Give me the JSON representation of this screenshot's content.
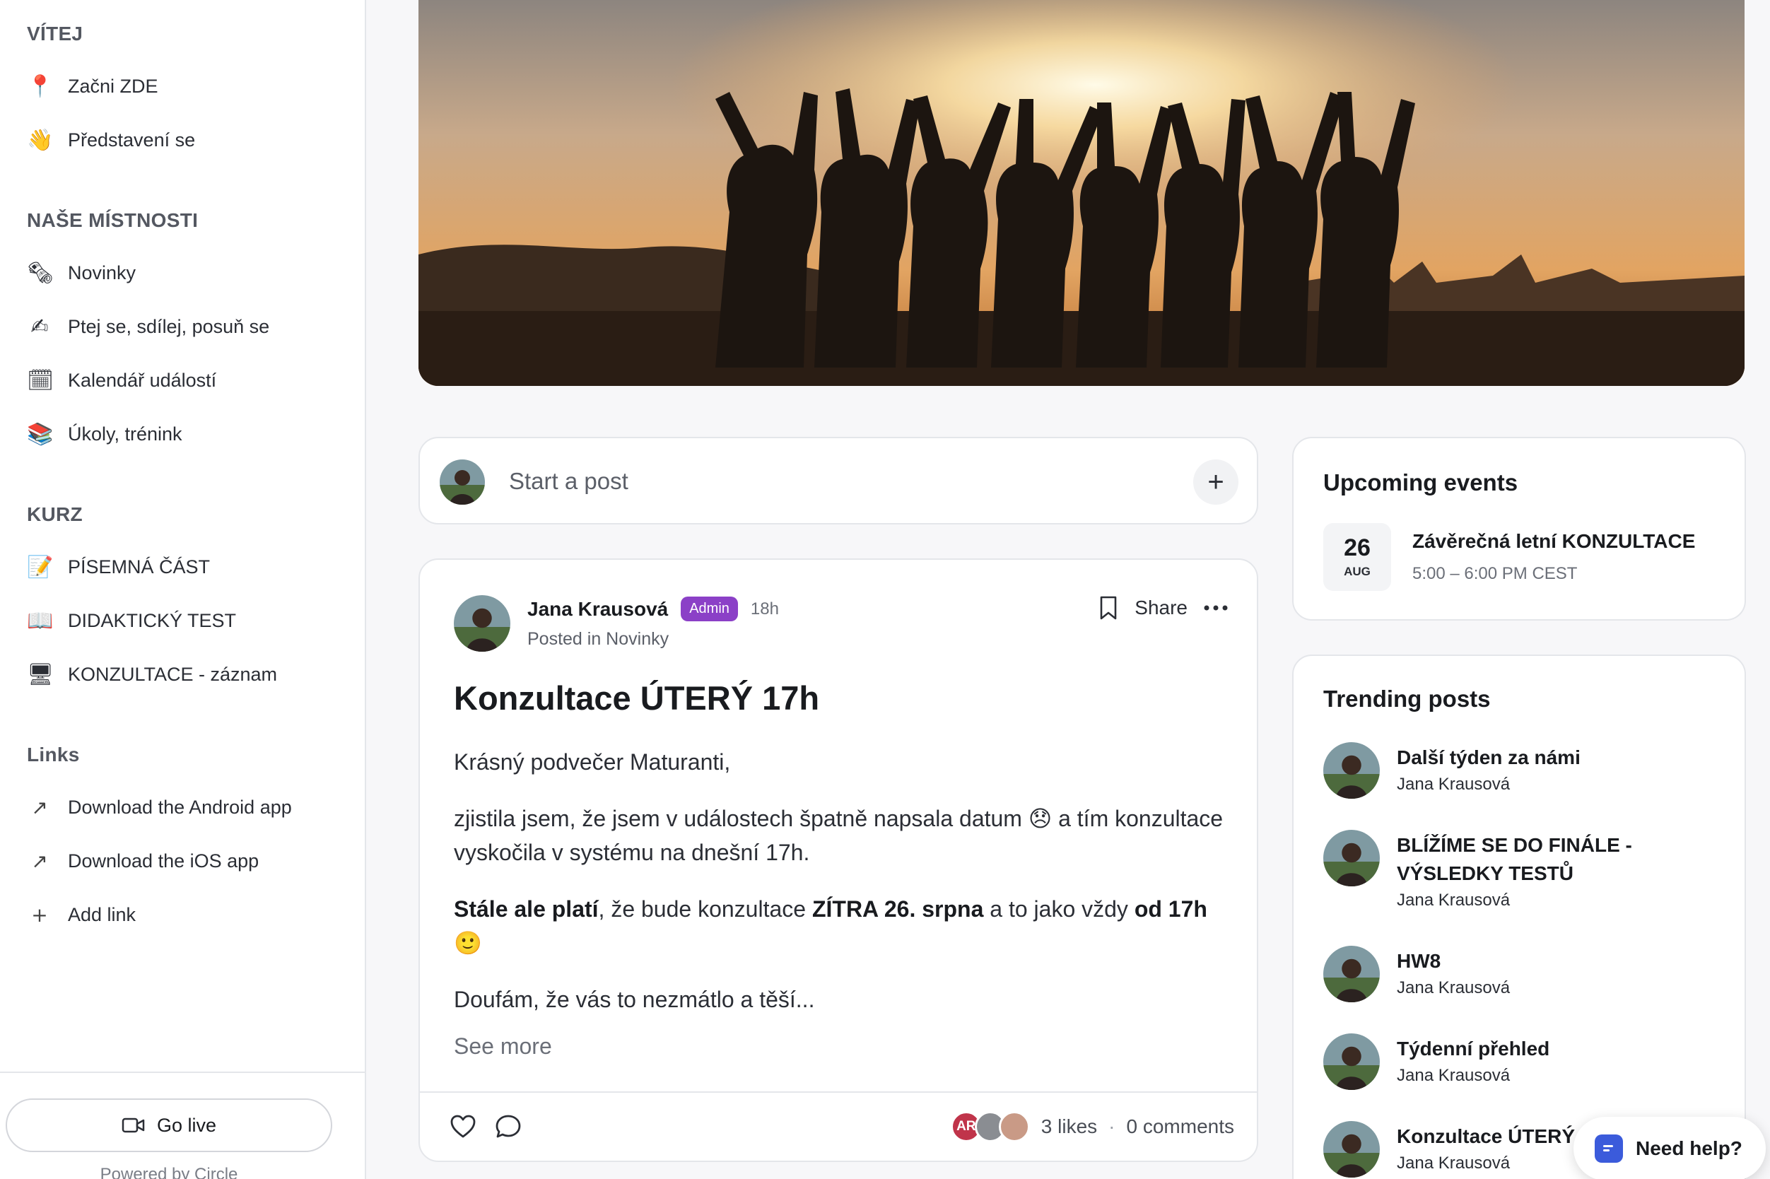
{
  "sidebar": {
    "sections": [
      {
        "title": "VÍTEJ"
      },
      {
        "title": "NAŠE MÍSTNOSTI"
      },
      {
        "title": "KURZ"
      },
      {
        "title": "Links"
      }
    ],
    "items": [
      {
        "label": "Začni ZDE",
        "icon": "📍"
      },
      {
        "label": "Představení se",
        "icon": "👋"
      },
      {
        "label": "Novinky",
        "icon": "🗞"
      },
      {
        "label": "Ptej se, sdílej, posuň se",
        "icon": "✍"
      },
      {
        "label": "Kalendář událostí",
        "icon": "🗓"
      },
      {
        "label": "Úkoly, trénink",
        "icon": "📚"
      },
      {
        "label": "PÍSEMNÁ ČÁST",
        "icon": "📝"
      },
      {
        "label": "DIDAKTICKÝ TEST",
        "icon": "📖"
      },
      {
        "label": "KONZULTACE - záznam",
        "icon": "🖥"
      },
      {
        "label": "Download the Android app",
        "icon": "↗"
      },
      {
        "label": "Download the iOS app",
        "icon": "↗"
      },
      {
        "label": "Add link",
        "icon": "+"
      }
    ],
    "go_live": "Go live",
    "powered_by": "Powered by Circle"
  },
  "composer": {
    "placeholder": "Start a post",
    "plus": "+"
  },
  "post": {
    "author": "Jana Krausová",
    "badge": "Admin",
    "time": "18h",
    "posted_in": "Posted in Novinky",
    "share": "Share",
    "title": "Konzultace ÚTERÝ 17h",
    "p1": "Krásný podvečer Maturanti,",
    "p2a": "zjistila jsem, že jsem v událostech špatně napsala datum",
    "p2emoji": "😞",
    "p2b": "a tím konzultace vyskočila v systému na dnešní 17h.",
    "p3_bold1": "Stále ale platí",
    "p3_t1": ", že bude konzultace ",
    "p3_bold2": "ZÍTRA 26. srpna",
    "p3_t2": " a to jako vždy ",
    "p3_bold3": "od 17h",
    "p3emoji": "🙂",
    "p4": "Doufám, že vás to nezmátlo a těší...",
    "see_more": "See more",
    "liker_initials": "AR",
    "likes": "3 likes",
    "separator": "·",
    "comments": "0 comments"
  },
  "events": {
    "title": "Upcoming events",
    "day": "26",
    "month": "AUG",
    "event_title": "Závěrečná letní KONZULTACE",
    "event_time": "5:00 – 6:00 PM CEST"
  },
  "trending": {
    "title": "Trending posts",
    "items": [
      {
        "title": "Další týden za námi",
        "author": "Jana Krausová"
      },
      {
        "title": "BLÍŽÍME SE DO FINÁLE - VÝSLEDKY TESTŮ",
        "author": "Jana Krausová"
      },
      {
        "title": "HW8",
        "author": "Jana Krausová"
      },
      {
        "title": "Týdenní přehled",
        "author": "Jana Krausová"
      },
      {
        "title": "Konzultace ÚTERÝ",
        "author": "Jana Krausová"
      }
    ]
  },
  "help": {
    "label": "Need help?"
  },
  "colors": {
    "accent": "#8b40c7",
    "help_icon": "#3b5bdb"
  }
}
